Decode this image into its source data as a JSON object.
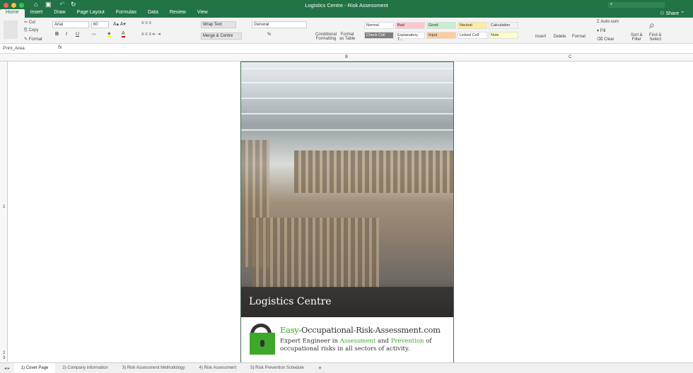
{
  "window": {
    "title": "Logistics Centre - Risk Assessment",
    "share": "Share"
  },
  "menu_tabs": [
    "Home",
    "Insert",
    "Draw",
    "Page Layout",
    "Formulas",
    "Data",
    "Review",
    "View"
  ],
  "ribbon": {
    "cut": "Cut",
    "copy": "Copy",
    "format": "Format",
    "font": "Arial",
    "size": "60",
    "bold": "B",
    "italic": "I",
    "underline": "U",
    "wrap": "Wrap Text",
    "merge": "Merge & Centre",
    "number_format": "General",
    "percent": "%",
    "cond1": "Conditional",
    "cond2": "Formatting",
    "fat1": "Format",
    "fat2": "as Table",
    "styles": [
      {
        "label": "Normal",
        "bg": "#ffffff"
      },
      {
        "label": "Bad",
        "bg": "#ffc7ce"
      },
      {
        "label": "Good",
        "bg": "#c6efce"
      },
      {
        "label": "Neutral",
        "bg": "#ffeb9c"
      },
      {
        "label": "Calculation",
        "bg": "#f2f2f2"
      },
      {
        "label": "Check Cell",
        "bg": "#a5a5a5"
      },
      {
        "label": "Explanatory T...",
        "bg": "#ffffff"
      },
      {
        "label": "Input",
        "bg": "#ffcc99"
      },
      {
        "label": "Linked Cell",
        "bg": "#ffffff"
      },
      {
        "label": "Note",
        "bg": "#ffffcc"
      }
    ],
    "insert": "Insert",
    "delete": "Delete",
    "format_cells": "Format",
    "autosum": "Auto-sum",
    "fill": "Fill",
    "clear": "Clear",
    "sort1": "Sort &",
    "sort2": "Filter",
    "find1": "Find &",
    "find2": "Select"
  },
  "formula_bar": {
    "name_box": "Print_Area",
    "fx": "fx"
  },
  "columns": [
    "B",
    "C"
  ],
  "rows": [
    "1",
    "2",
    "3"
  ],
  "cover": {
    "caption": "Logistics Centre",
    "site_easy": "Easy",
    "site_rest": "-Occupational-Risk-Assessment.com",
    "tag_1": "Expert Engineer in ",
    "tag_assess": "Assessment",
    "tag_and": " and ",
    "tag_prev": "Prevention",
    "tag_2": " of occupational risks in all sectors of activity."
  },
  "sheet_tabs": [
    "1) Cover Page",
    "2) Company Information",
    "3) Risk Assessment Methodology",
    "4) Risk Assessment",
    "5) Risk Prevention Schedule"
  ],
  "add_sheet": "+"
}
